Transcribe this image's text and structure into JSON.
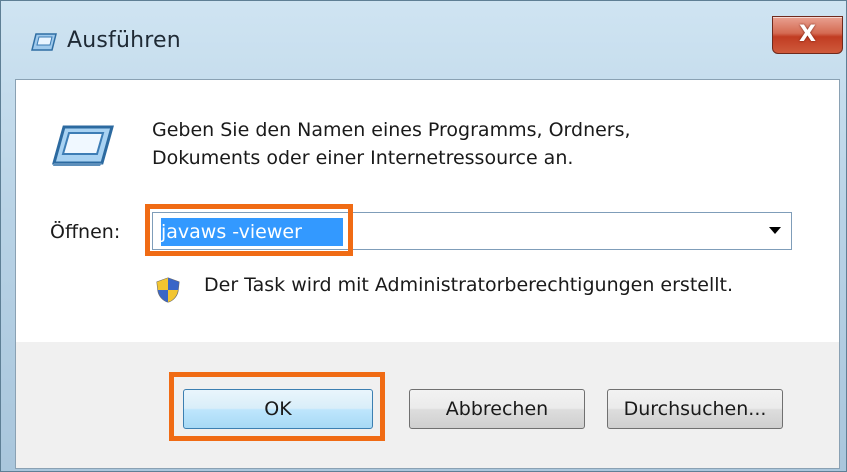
{
  "window": {
    "title": "Ausführen",
    "close_label": "X"
  },
  "dialog": {
    "prompt_line1": "Geben Sie den Namen eines Programms, Ordners,",
    "prompt_line2": "Dokuments oder einer Internetressource an.",
    "open_label": "Öffnen:",
    "command_value": "javaws -viewer",
    "admin_note": "Der Task wird mit Administratorberechtigungen erstellt."
  },
  "buttons": {
    "ok": "OK",
    "cancel": "Abbrechen",
    "browse": "Durchsuchen..."
  },
  "icons": {
    "title": "run-icon",
    "dialog": "run-icon",
    "shield": "uac-shield-icon",
    "dropdown": "chevron-down-icon"
  },
  "colors": {
    "highlight": "#f06b14",
    "selection": "#3399ff",
    "close_button": "#c13c22"
  }
}
